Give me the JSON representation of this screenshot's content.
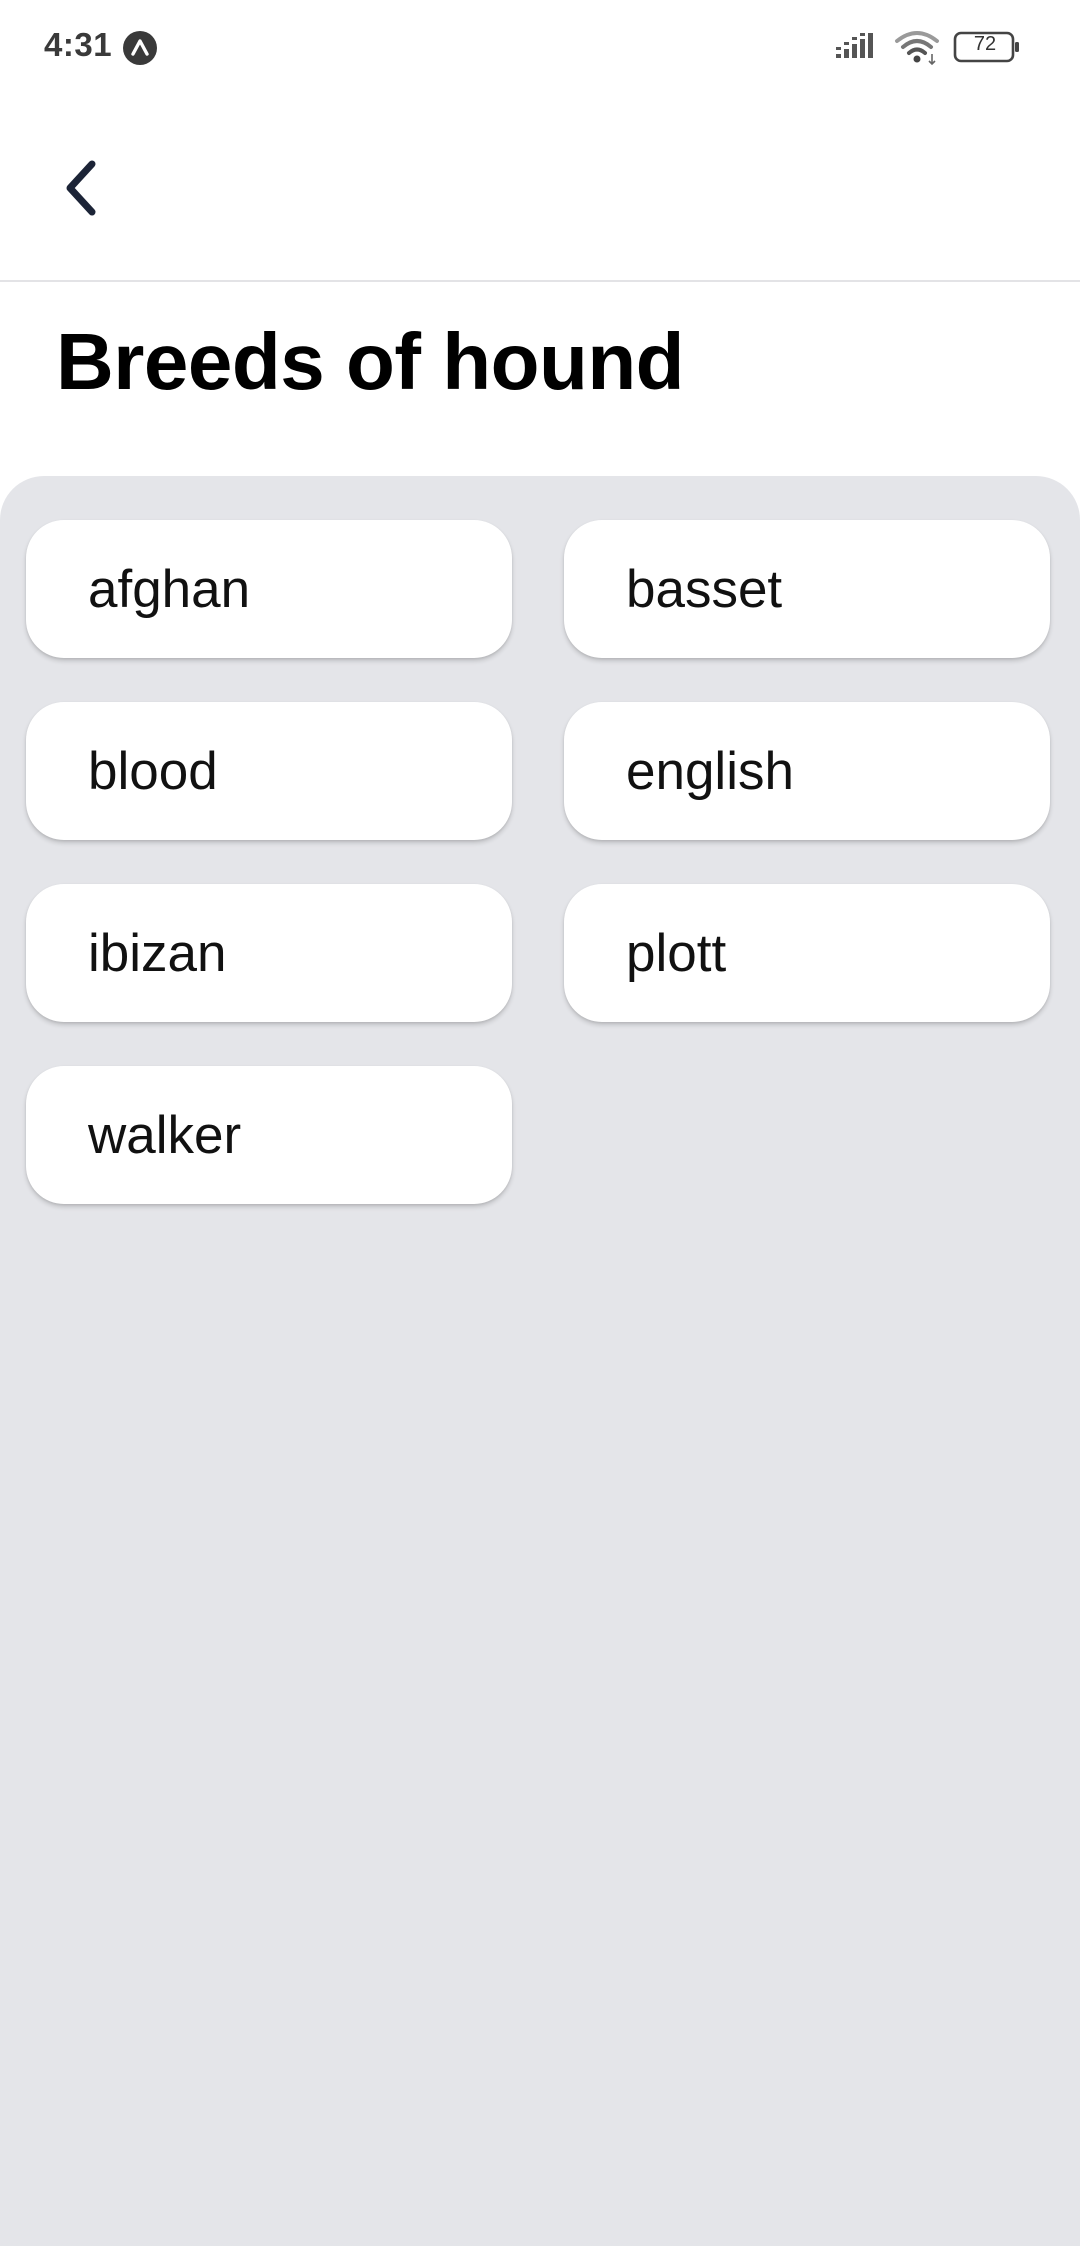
{
  "status_bar": {
    "time": "4:31",
    "battery_level": "72",
    "icons": [
      "app-notification-icon",
      "signal-icon",
      "wifi-icon",
      "battery-icon"
    ]
  },
  "toolbar": {
    "back_icon": "chevron-left-icon"
  },
  "page": {
    "title": "Breeds of hound"
  },
  "breeds": [
    {
      "label": "afghan"
    },
    {
      "label": "basset"
    },
    {
      "label": "blood"
    },
    {
      "label": "english"
    },
    {
      "label": "ibizan"
    },
    {
      "label": "plott"
    },
    {
      "label": "walker"
    }
  ],
  "colors": {
    "panel_background": "#e4e5e9",
    "card_background": "#ffffff",
    "title_text": "#000000",
    "back_icon": "#1c2437"
  }
}
